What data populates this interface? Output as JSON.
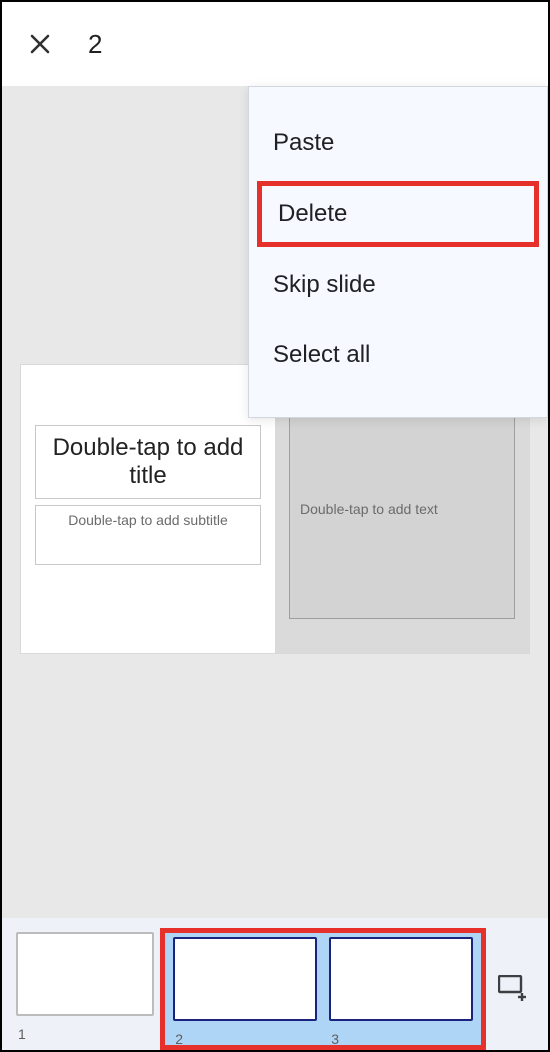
{
  "topbar": {
    "selected_count": "2"
  },
  "menu": {
    "paste": "Paste",
    "delete": "Delete",
    "skip": "Skip slide",
    "select_all": "Select all"
  },
  "editor": {
    "title_placeholder": "Double-tap to add title",
    "subtitle_placeholder": "Double-tap to add subtitle",
    "text_placeholder": "Double-tap to add text"
  },
  "filmstrip": {
    "thumbs": [
      {
        "label": "1"
      },
      {
        "label": "2"
      },
      {
        "label": "3"
      }
    ]
  }
}
